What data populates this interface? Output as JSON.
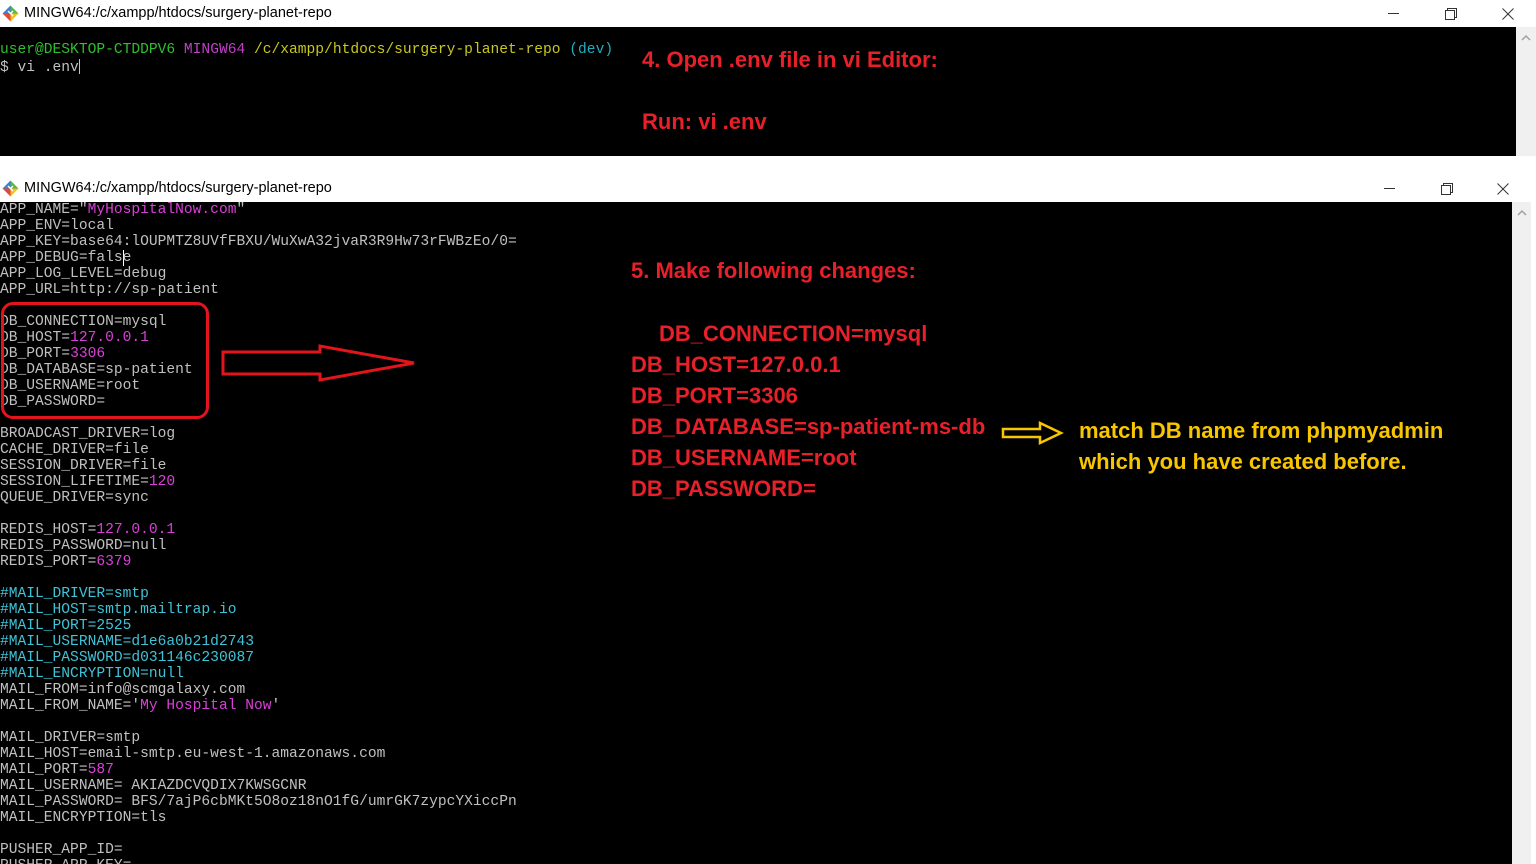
{
  "icons": {
    "app": "git-bash-icon",
    "minimize": "minimize-icon",
    "restore": "restore-icon",
    "close": "close-icon",
    "scroll_up": "chevron-up-icon"
  },
  "colors": {
    "terminal_bg": "#000000",
    "terminal_fg": "#c0c0c0",
    "prompt_green": "#2fbf2f",
    "prompt_magenta": "#c040c8",
    "prompt_yellow": "#c8c81e",
    "prompt_cyan": "#20aebd",
    "syntax_string": "#d940d9",
    "syntax_comment": "#3fc3d6",
    "annotation_red": "#e8202a",
    "annotation_yellow": "#f7c600"
  },
  "top_window": {
    "title": "MINGW64:/c/xampp/htdocs/surgery-planet-repo",
    "prompt": {
      "user_host": "user@DESKTOP-CTDDPV6",
      "system": "MINGW64",
      "path": "/c/xampp/htdocs/surgery-planet-repo",
      "branch": "(dev)"
    },
    "command": "$ vi .env"
  },
  "editor_window": {
    "title": "MINGW64:/c/xampp/htdocs/surgery-planet-repo",
    "lines": [
      [
        {
          "t": "APP_NAME=\"",
          "c": "#c0c0c0"
        },
        {
          "t": "MyHospitalNow.com",
          "c": "#d940d9"
        },
        {
          "t": "\"",
          "c": "#c0c0c0"
        }
      ],
      [
        {
          "t": "APP_ENV=local",
          "c": "#c0c0c0"
        }
      ],
      [
        {
          "t": "APP_KEY=base64:lOUPMTZ8UVfFBXU/WuXwA32jvaR3R9Hw73rFWBzEo/0=",
          "c": "#c0c0c0"
        }
      ],
      [
        {
          "t": "APP_DEBUG=fals",
          "c": "#c0c0c0"
        },
        {
          "t": "e",
          "c": "#c0c0c0",
          "cursor": true
        }
      ],
      [
        {
          "t": "APP_LOG_LEVEL=debug",
          "c": "#c0c0c0"
        }
      ],
      [
        {
          "t": "APP_URL=http://sp-patient",
          "c": "#c0c0c0"
        }
      ],
      [],
      [
        {
          "t": "DB_CONNECTION=mysql",
          "c": "#c0c0c0"
        }
      ],
      [
        {
          "t": "DB_HOST=",
          "c": "#c0c0c0"
        },
        {
          "t": "127.0.0.1",
          "c": "#d940d9"
        }
      ],
      [
        {
          "t": "DB_PORT=",
          "c": "#c0c0c0"
        },
        {
          "t": "3306",
          "c": "#d940d9"
        }
      ],
      [
        {
          "t": "DB_DATABASE=sp-patient",
          "c": "#c0c0c0"
        }
      ],
      [
        {
          "t": "DB_USERNAME=root",
          "c": "#c0c0c0"
        }
      ],
      [
        {
          "t": "DB_PASSWORD=",
          "c": "#c0c0c0"
        }
      ],
      [],
      [
        {
          "t": "BROADCAST_DRIVER=log",
          "c": "#c0c0c0"
        }
      ],
      [
        {
          "t": "CACHE_DRIVER=file",
          "c": "#c0c0c0"
        }
      ],
      [
        {
          "t": "SESSION_DRIVER=file",
          "c": "#c0c0c0"
        }
      ],
      [
        {
          "t": "SESSION_LIFETIME=",
          "c": "#c0c0c0"
        },
        {
          "t": "120",
          "c": "#d940d9"
        }
      ],
      [
        {
          "t": "QUEUE_DRIVER=sync",
          "c": "#c0c0c0"
        }
      ],
      [],
      [
        {
          "t": "REDIS_HOST=",
          "c": "#c0c0c0"
        },
        {
          "t": "127.0.0.1",
          "c": "#d940d9"
        }
      ],
      [
        {
          "t": "REDIS_PASSWORD=null",
          "c": "#c0c0c0"
        }
      ],
      [
        {
          "t": "REDIS_PORT=",
          "c": "#c0c0c0"
        },
        {
          "t": "6379",
          "c": "#d940d9"
        }
      ],
      [],
      [
        {
          "t": "#MAIL_DRIVER=smtp",
          "c": "#3fc3d6"
        }
      ],
      [
        {
          "t": "#MAIL_HOST=smtp.mailtrap.io",
          "c": "#3fc3d6"
        }
      ],
      [
        {
          "t": "#MAIL_PORT=2525",
          "c": "#3fc3d6"
        }
      ],
      [
        {
          "t": "#MAIL_USERNAME=d1e6a0b21d2743",
          "c": "#3fc3d6"
        }
      ],
      [
        {
          "t": "#MAIL_PASSWORD=d031146c230087",
          "c": "#3fc3d6"
        }
      ],
      [
        {
          "t": "#MAIL_ENCRYPTION=null",
          "c": "#3fc3d6"
        }
      ],
      [
        {
          "t": "MAIL_FROM=info@scmgalaxy.com",
          "c": "#c0c0c0"
        }
      ],
      [
        {
          "t": "MAIL_FROM_NAME='",
          "c": "#c0c0c0"
        },
        {
          "t": "My Hospital Now",
          "c": "#d940d9"
        },
        {
          "t": "'",
          "c": "#c0c0c0"
        }
      ],
      [],
      [
        {
          "t": "MAIL_DRIVER=smtp",
          "c": "#c0c0c0"
        }
      ],
      [
        {
          "t": "MAIL_HOST=email-smtp.eu-west-1.amazonaws.com",
          "c": "#c0c0c0"
        }
      ],
      [
        {
          "t": "MAIL_PORT=",
          "c": "#c0c0c0"
        },
        {
          "t": "587",
          "c": "#d940d9"
        }
      ],
      [
        {
          "t": "MAIL_USERNAME= AKIAZDCVQDIX7KWSGCNR",
          "c": "#c0c0c0"
        }
      ],
      [
        {
          "t": "MAIL_PASSWORD= BFS/7ajP6cbMKt5O8oz18nO1fG/umrGK7zypcYXiccPn",
          "c": "#c0c0c0"
        }
      ],
      [
        {
          "t": "MAIL_ENCRYPTION=tls",
          "c": "#c0c0c0"
        }
      ],
      [],
      [
        {
          "t": "PUSHER_APP_ID=",
          "c": "#c0c0c0"
        }
      ],
      [
        {
          "t": "PUSHER_APP_KEY=",
          "c": "#c0c0c0"
        }
      ]
    ]
  },
  "annotations": {
    "step4": {
      "title": "4. Open .env file in vi Editor:",
      "run": "Run: vi .env"
    },
    "step5": {
      "title": "5. Make following changes:",
      "lines": [
        "DB_CONNECTION=mysql",
        "DB_HOST=127.0.0.1",
        "DB_PORT=3306",
        "DB_DATABASE=sp-patient-ms-db",
        "DB_USERNAME=root",
        "DB_PASSWORD="
      ]
    },
    "note": {
      "lines": [
        "match DB name from phpmyadmin",
        "which you have created before."
      ]
    }
  }
}
